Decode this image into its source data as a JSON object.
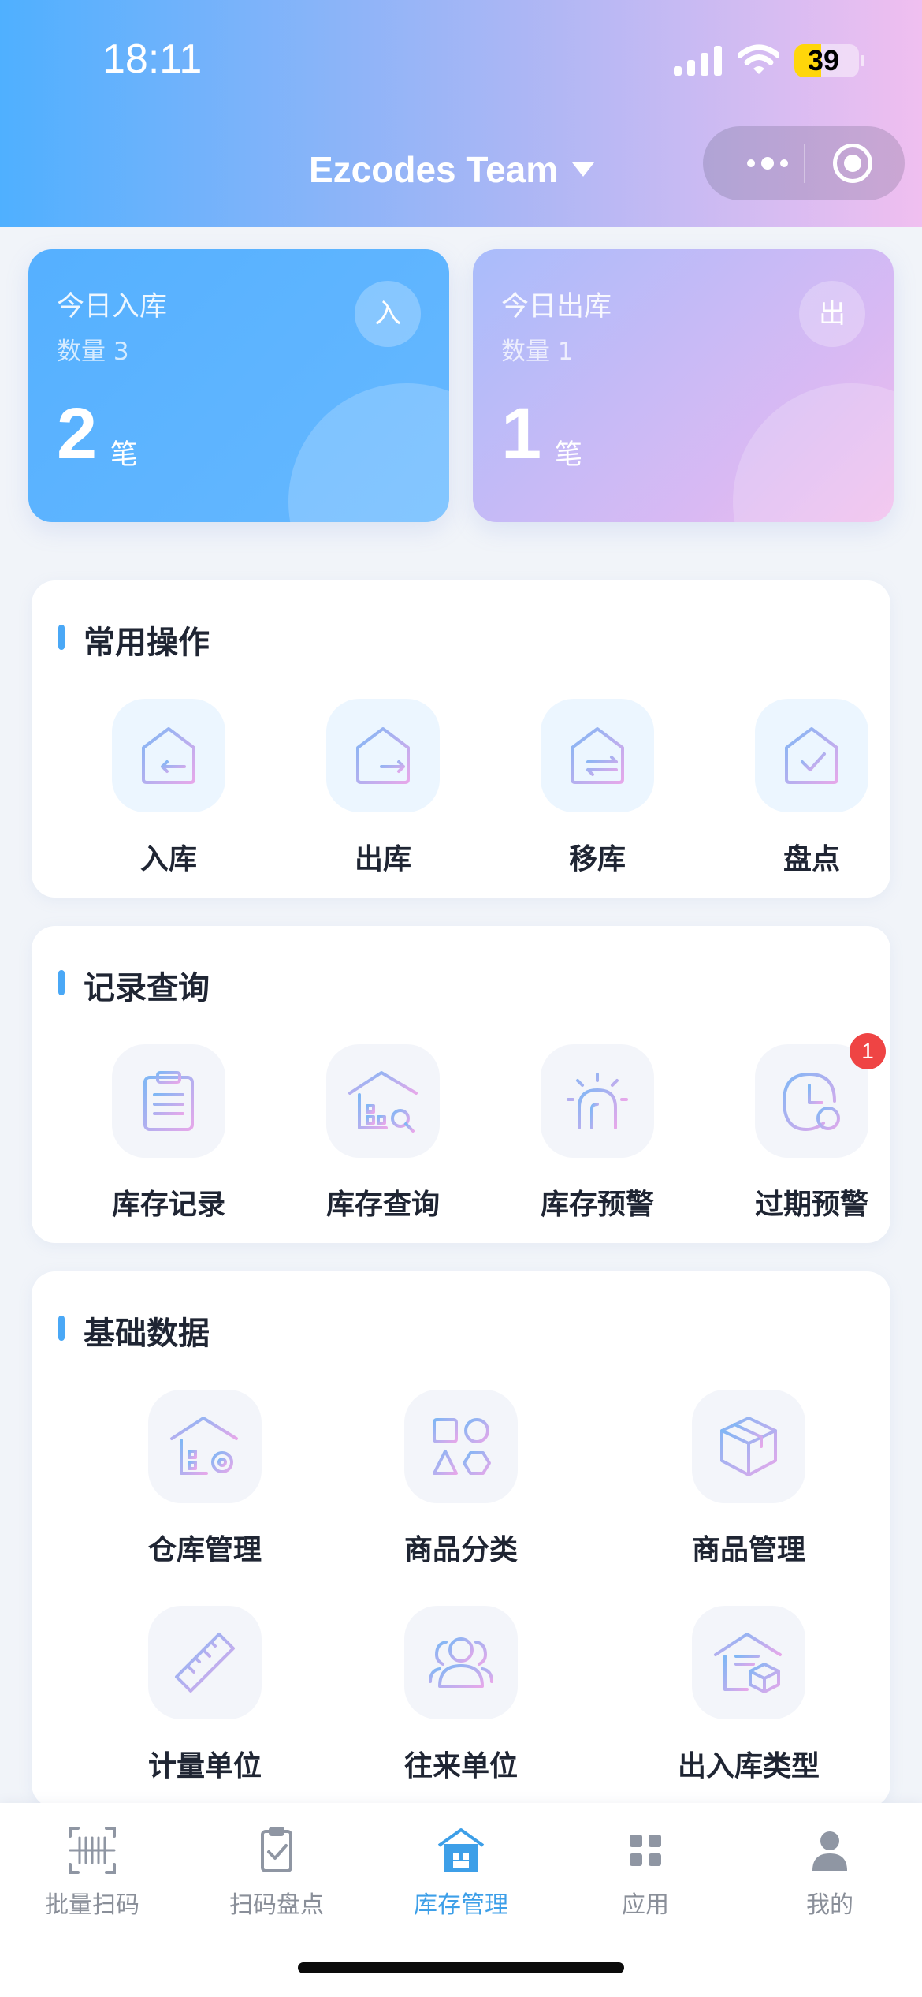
{
  "status_bar": {
    "time": "18:11",
    "battery": "39"
  },
  "header": {
    "team_name": "Ezcodes Team"
  },
  "stats": {
    "inbound": {
      "title": "今日入库",
      "quantity": "数量 3",
      "value": "2",
      "unit": "笔",
      "badge": "入"
    },
    "outbound": {
      "title": "今日出库",
      "quantity": "数量 1",
      "value": "1",
      "unit": "笔",
      "badge": "出"
    }
  },
  "common_ops": {
    "title": "常用操作",
    "items": [
      {
        "label": "入库",
        "icon": "warehouse-in-icon"
      },
      {
        "label": "出库",
        "icon": "warehouse-out-icon"
      },
      {
        "label": "移库",
        "icon": "warehouse-move-icon"
      },
      {
        "label": "盘点",
        "icon": "warehouse-check-icon"
      }
    ]
  },
  "records": {
    "title": "记录查询",
    "items": [
      {
        "label": "库存记录",
        "icon": "clipboard-icon"
      },
      {
        "label": "库存查询",
        "icon": "warehouse-search-icon"
      },
      {
        "label": "库存预警",
        "icon": "alarm-light-icon"
      },
      {
        "label": "过期预警",
        "icon": "clock-alert-icon",
        "badge": "1"
      }
    ]
  },
  "basic_data": {
    "title": "基础数据",
    "items": [
      {
        "label": "仓库管理",
        "icon": "warehouse-settings-icon"
      },
      {
        "label": "商品分类",
        "icon": "shapes-icon"
      },
      {
        "label": "商品管理",
        "icon": "box-icon"
      },
      {
        "label": "计量单位",
        "icon": "ruler-icon"
      },
      {
        "label": "往来单位",
        "icon": "people-icon"
      },
      {
        "label": "出入库类型",
        "icon": "warehouse-box-icon"
      }
    ]
  },
  "tabbar": {
    "items": [
      {
        "label": "批量扫码",
        "icon": "barcode-scan-icon"
      },
      {
        "label": "扫码盘点",
        "icon": "clipboard-check-icon"
      },
      {
        "label": "库存管理",
        "icon": "warehouse-icon",
        "active": true
      },
      {
        "label": "应用",
        "icon": "grid-icon"
      },
      {
        "label": "我的",
        "icon": "user-icon"
      }
    ]
  },
  "colors": {
    "accent": "#3d9fe8",
    "badge": "#ef4444"
  }
}
